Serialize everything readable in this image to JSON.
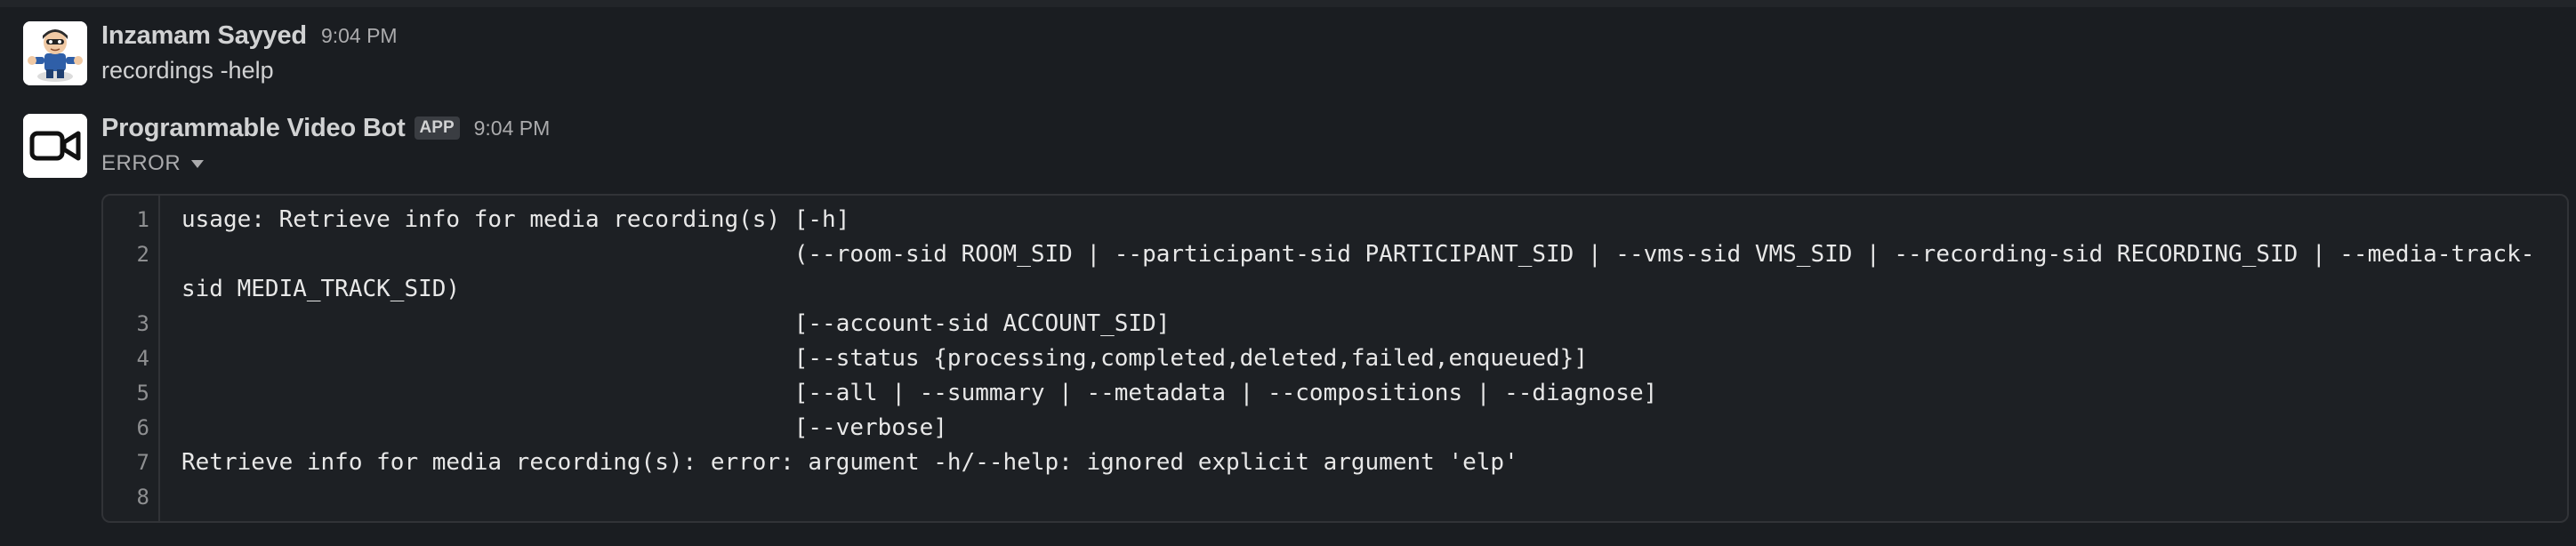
{
  "messages": {
    "user": {
      "avatar_icon": "cartoon-user-avatar-icon",
      "name": "Inzamam Sayyed",
      "time": "9:04 PM",
      "text": "recordings -help"
    },
    "bot": {
      "avatar_icon": "video-camera-icon",
      "name": "Programmable Video Bot",
      "badge": "APP",
      "time": "9:04 PM",
      "status": "ERROR"
    }
  },
  "code": {
    "line_numbers": [
      "1",
      "2",
      "3",
      "4",
      "5",
      "6",
      "7",
      "8"
    ],
    "lines": [
      "usage: Retrieve info for media recording(s) [-h]",
      "                                            (--room-sid ROOM_SID | --participant-sid PARTICIPANT_SID | --vms-sid VMS_SID | --recording-sid RECORDING_SID | --media-track-",
      "sid MEDIA_TRACK_SID)",
      "                                            [--account-sid ACCOUNT_SID]",
      "                                            [--status {processing,completed,deleted,failed,enqueued}]",
      "                                            [--all | --summary | --metadata | --compositions | --diagnose]",
      "                                            [--verbose]",
      "Retrieve info for media recording(s): error: argument -h/--help: ignored explicit argument 'elp'",
      ""
    ]
  },
  "colors": {
    "background": "#1a1d21",
    "code_background": "#1d2024",
    "text_primary": "#d1d2d3",
    "text_secondary": "#ababad"
  }
}
